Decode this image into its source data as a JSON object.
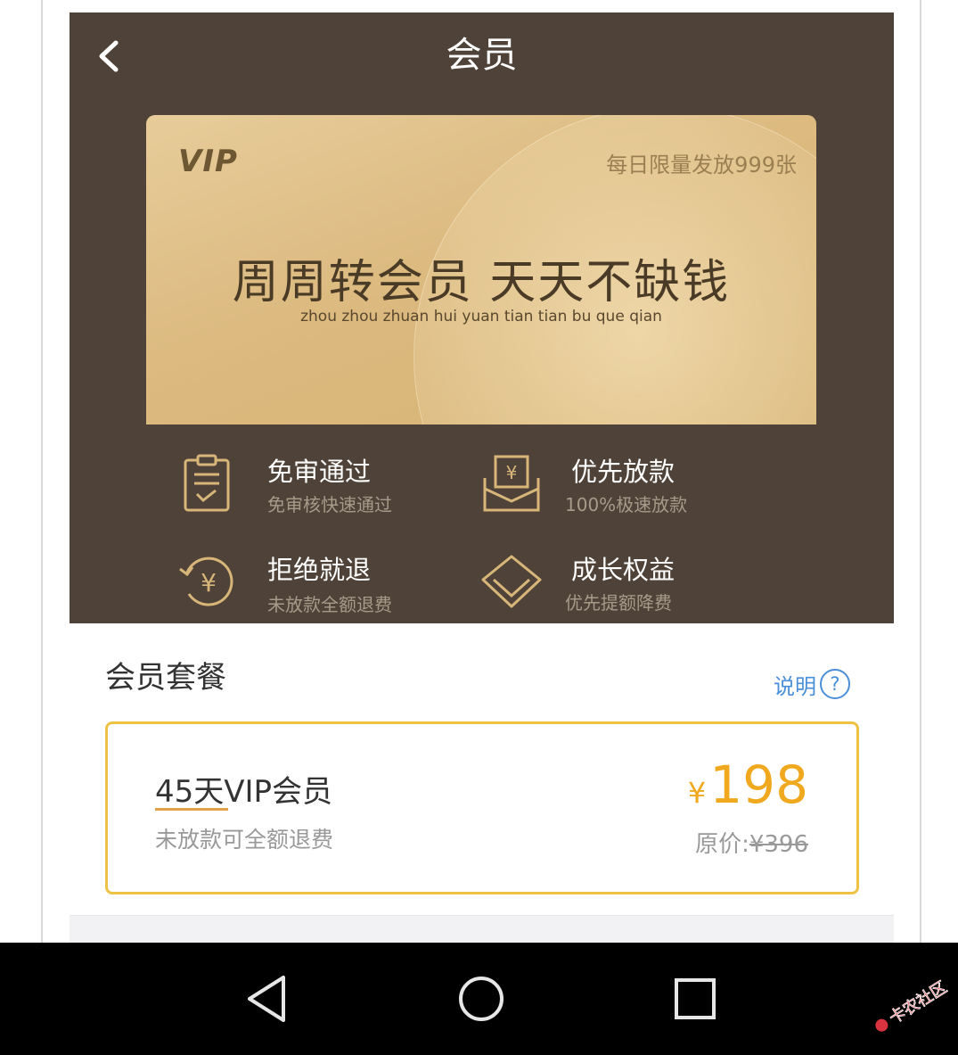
{
  "header": {
    "title": "会员"
  },
  "card": {
    "badge": "VIP",
    "limit_text": "每日限量发放999张",
    "slogan": "周周转会员  天天不缺钱",
    "pinyin": "zhou zhou zhuan hui yuan tian tian bu que qian"
  },
  "benefits": [
    {
      "title": "免审通过",
      "subtitle": "免审核快速通过",
      "icon": "clipboard-check-icon"
    },
    {
      "title": "优先放款",
      "subtitle": "100%极速放款",
      "icon": "yuan-envelope-icon"
    },
    {
      "title": "拒绝就退",
      "subtitle": "未放款全额退费",
      "icon": "yuan-refund-icon"
    },
    {
      "title": "成长权益",
      "subtitle": "优先提额降费",
      "icon": "diamond-icon"
    }
  ],
  "plans_section": {
    "title": "会员套餐",
    "help_label": "说明",
    "help_icon_glyph": "?"
  },
  "plan": {
    "name": "45天VIP会员",
    "note": "未放款可全额退费",
    "currency": "¥",
    "price": "198",
    "original_label": "原价:",
    "original_price": "¥396"
  },
  "watermark": {
    "text": "卡农社区"
  },
  "colors": {
    "header_bg": "#4f4339",
    "card_gold": "#dcba80",
    "price_orange": "#f0a81e",
    "plan_border": "#eec244",
    "link_blue": "#4a8fd8"
  }
}
